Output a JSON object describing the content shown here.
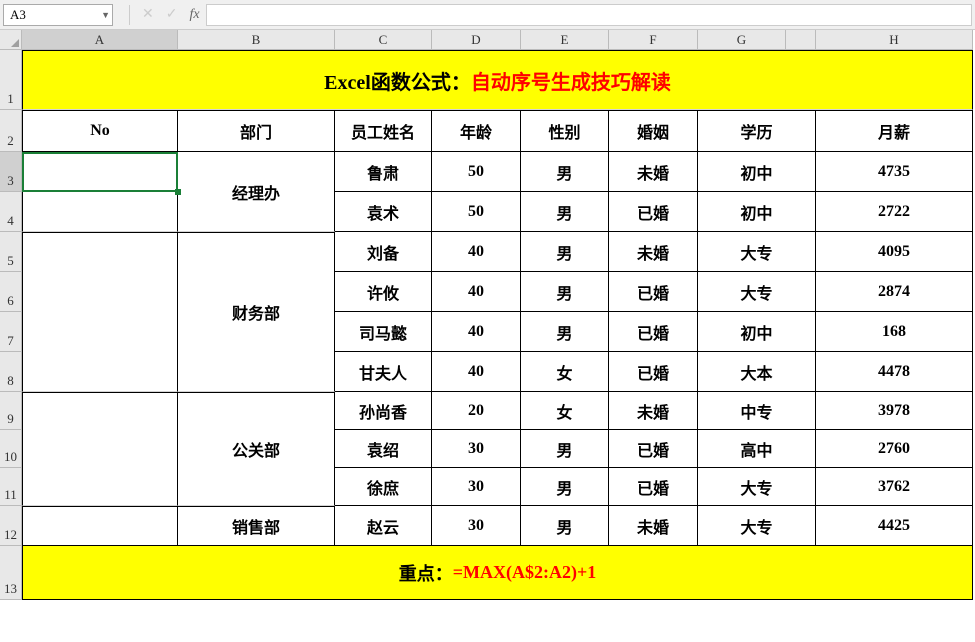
{
  "nameBox": "A3",
  "formulaBarValue": "",
  "columns": [
    "A",
    "B",
    "C",
    "D",
    "E",
    "F",
    "G",
    "",
    "H"
  ],
  "rowNumbers": [
    "1",
    "2",
    "3",
    "4",
    "5",
    "6",
    "7",
    "8",
    "9",
    "10",
    "11",
    "12",
    "13"
  ],
  "title": {
    "prefix": "Excel函数公式：",
    "main": "自动序号生成技巧解读"
  },
  "headers": {
    "A": "No",
    "B": "部门",
    "C": "员工姓名",
    "D": "年龄",
    "E": "性别",
    "F": "婚姻",
    "G": "学历",
    "H": "月薪"
  },
  "depts": {
    "d1": "经理办",
    "d2": "财务部",
    "d3": "公关部",
    "d4": "销售部"
  },
  "rows": [
    {
      "name": "鲁肃",
      "age": "50",
      "sex": "男",
      "marry": "未婚",
      "edu": "初中",
      "salary": "4735"
    },
    {
      "name": "袁术",
      "age": "50",
      "sex": "男",
      "marry": "已婚",
      "edu": "初中",
      "salary": "2722"
    },
    {
      "name": "刘备",
      "age": "40",
      "sex": "男",
      "marry": "未婚",
      "edu": "大专",
      "salary": "4095"
    },
    {
      "name": "许攸",
      "age": "40",
      "sex": "男",
      "marry": "已婚",
      "edu": "大专",
      "salary": "2874"
    },
    {
      "name": "司马懿",
      "age": "40",
      "sex": "男",
      "marry": "已婚",
      "edu": "初中",
      "salary": "168"
    },
    {
      "name": "甘夫人",
      "age": "40",
      "sex": "女",
      "marry": "已婚",
      "edu": "大本",
      "salary": "4478"
    },
    {
      "name": "孙尚香",
      "age": "20",
      "sex": "女",
      "marry": "未婚",
      "edu": "中专",
      "salary": "3978"
    },
    {
      "name": "袁绍",
      "age": "30",
      "sex": "男",
      "marry": "已婚",
      "edu": "高中",
      "salary": "2760"
    },
    {
      "name": "徐庶",
      "age": "30",
      "sex": "男",
      "marry": "已婚",
      "edu": "大专",
      "salary": "3762"
    },
    {
      "name": "赵云",
      "age": "30",
      "sex": "男",
      "marry": "未婚",
      "edu": "大专",
      "salary": "4425"
    }
  ],
  "footer": {
    "label": "重点：",
    "formula": "=MAX(A$2:A2)+1"
  },
  "activeCell": "A3",
  "chart_data": {
    "type": "table",
    "title": "Excel函数公式：自动序号生成技巧解读",
    "columns": [
      "No",
      "部门",
      "员工姓名",
      "年龄",
      "性别",
      "婚姻",
      "学历",
      "月薪"
    ],
    "rows": [
      [
        "",
        "经理办",
        "鲁肃",
        50,
        "男",
        "未婚",
        "初中",
        4735
      ],
      [
        "",
        "经理办",
        "袁术",
        50,
        "男",
        "已婚",
        "初中",
        2722
      ],
      [
        "",
        "财务部",
        "刘备",
        40,
        "男",
        "未婚",
        "大专",
        4095
      ],
      [
        "",
        "财务部",
        "许攸",
        40,
        "男",
        "已婚",
        "大专",
        2874
      ],
      [
        "",
        "财务部",
        "司马懿",
        40,
        "男",
        "已婚",
        "初中",
        168
      ],
      [
        "",
        "财务部",
        "甘夫人",
        40,
        "女",
        "已婚",
        "大本",
        4478
      ],
      [
        "",
        "公关部",
        "孙尚香",
        20,
        "女",
        "未婚",
        "中专",
        3978
      ],
      [
        "",
        "公关部",
        "袁绍",
        30,
        "男",
        "已婚",
        "高中",
        2760
      ],
      [
        "",
        "公关部",
        "徐庶",
        30,
        "男",
        "已婚",
        "大专",
        3762
      ],
      [
        "",
        "销售部",
        "赵云",
        30,
        "男",
        "未婚",
        "大专",
        4425
      ]
    ],
    "footer_formula": "=MAX(A$2:A2)+1"
  }
}
